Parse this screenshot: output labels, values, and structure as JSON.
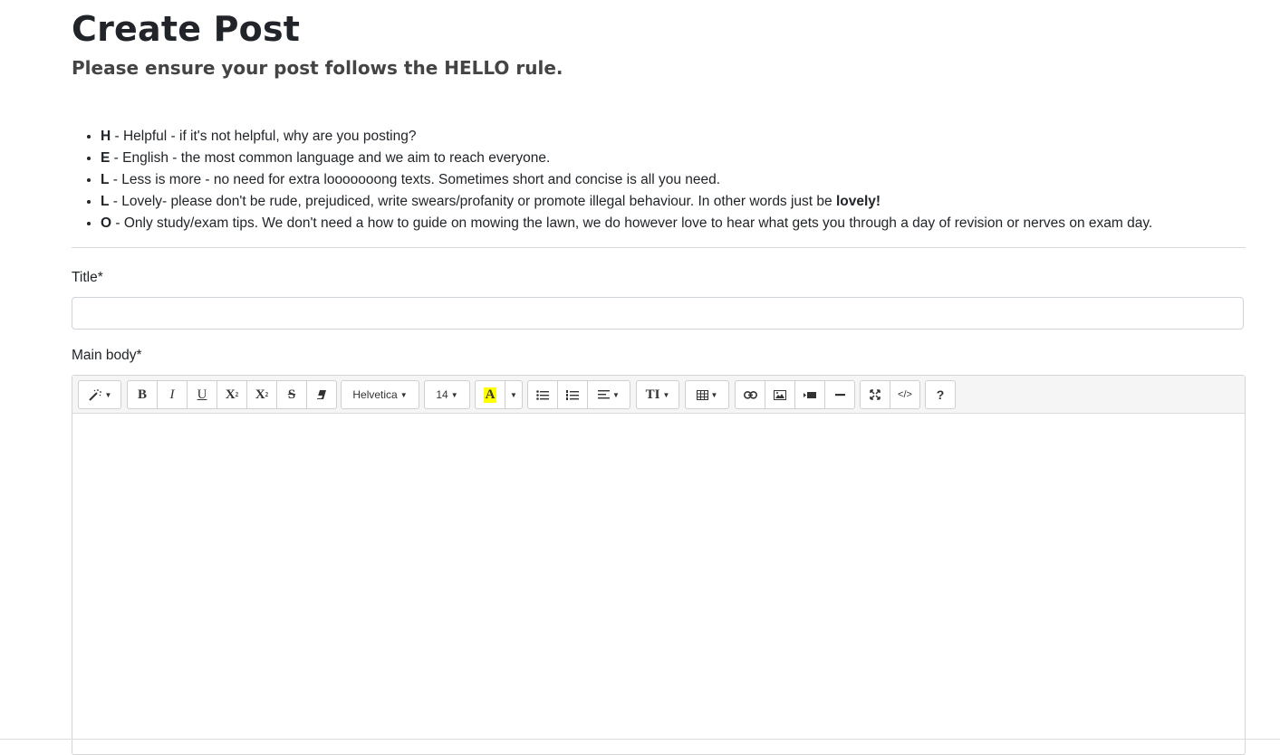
{
  "page": {
    "title": "Create Post",
    "subtitle": "Please ensure your post follows the HELLO rule."
  },
  "rules": [
    {
      "letter": "H",
      "text": " - Helpful - if it's not helpful, why are you posting?",
      "bold_suffix": "",
      "suffix": ""
    },
    {
      "letter": "E",
      "text": " - English - the most common language and we aim to reach everyone.",
      "bold_suffix": "",
      "suffix": ""
    },
    {
      "letter": "L",
      "text": " - Less is more - no need for extra looooooong texts. Sometimes short and concise is all you need.",
      "bold_suffix": "",
      "suffix": ""
    },
    {
      "letter": "L",
      "text": " - Lovely- please don't be rude, prejudiced, write swears/profanity or promote illegal behaviour. In other words just be ",
      "bold_suffix": "lovely!",
      "suffix": ""
    },
    {
      "letter": "O",
      "text": " - Only study/exam tips. We don't need a how to guide on mowing the lawn, we do however love to hear what gets you through a day of revision or nerves on exam day.",
      "bold_suffix": "",
      "suffix": ""
    }
  ],
  "form": {
    "title_label": "Title*",
    "title_value": "",
    "body_label": "Main body*"
  },
  "toolbar": {
    "font_name": "Helvetica",
    "font_size": "14",
    "bold": "B",
    "italic": "I",
    "underline": "U",
    "superscript": "X",
    "subscript": "X",
    "strike": "S",
    "forecolor": "A",
    "lineheight": "TI",
    "codeview": "</>",
    "help": "?"
  },
  "colors": {
    "highlight": "#ffff00",
    "border": "#cfcfcf",
    "toolbar_bg": "#f5f5f5"
  }
}
